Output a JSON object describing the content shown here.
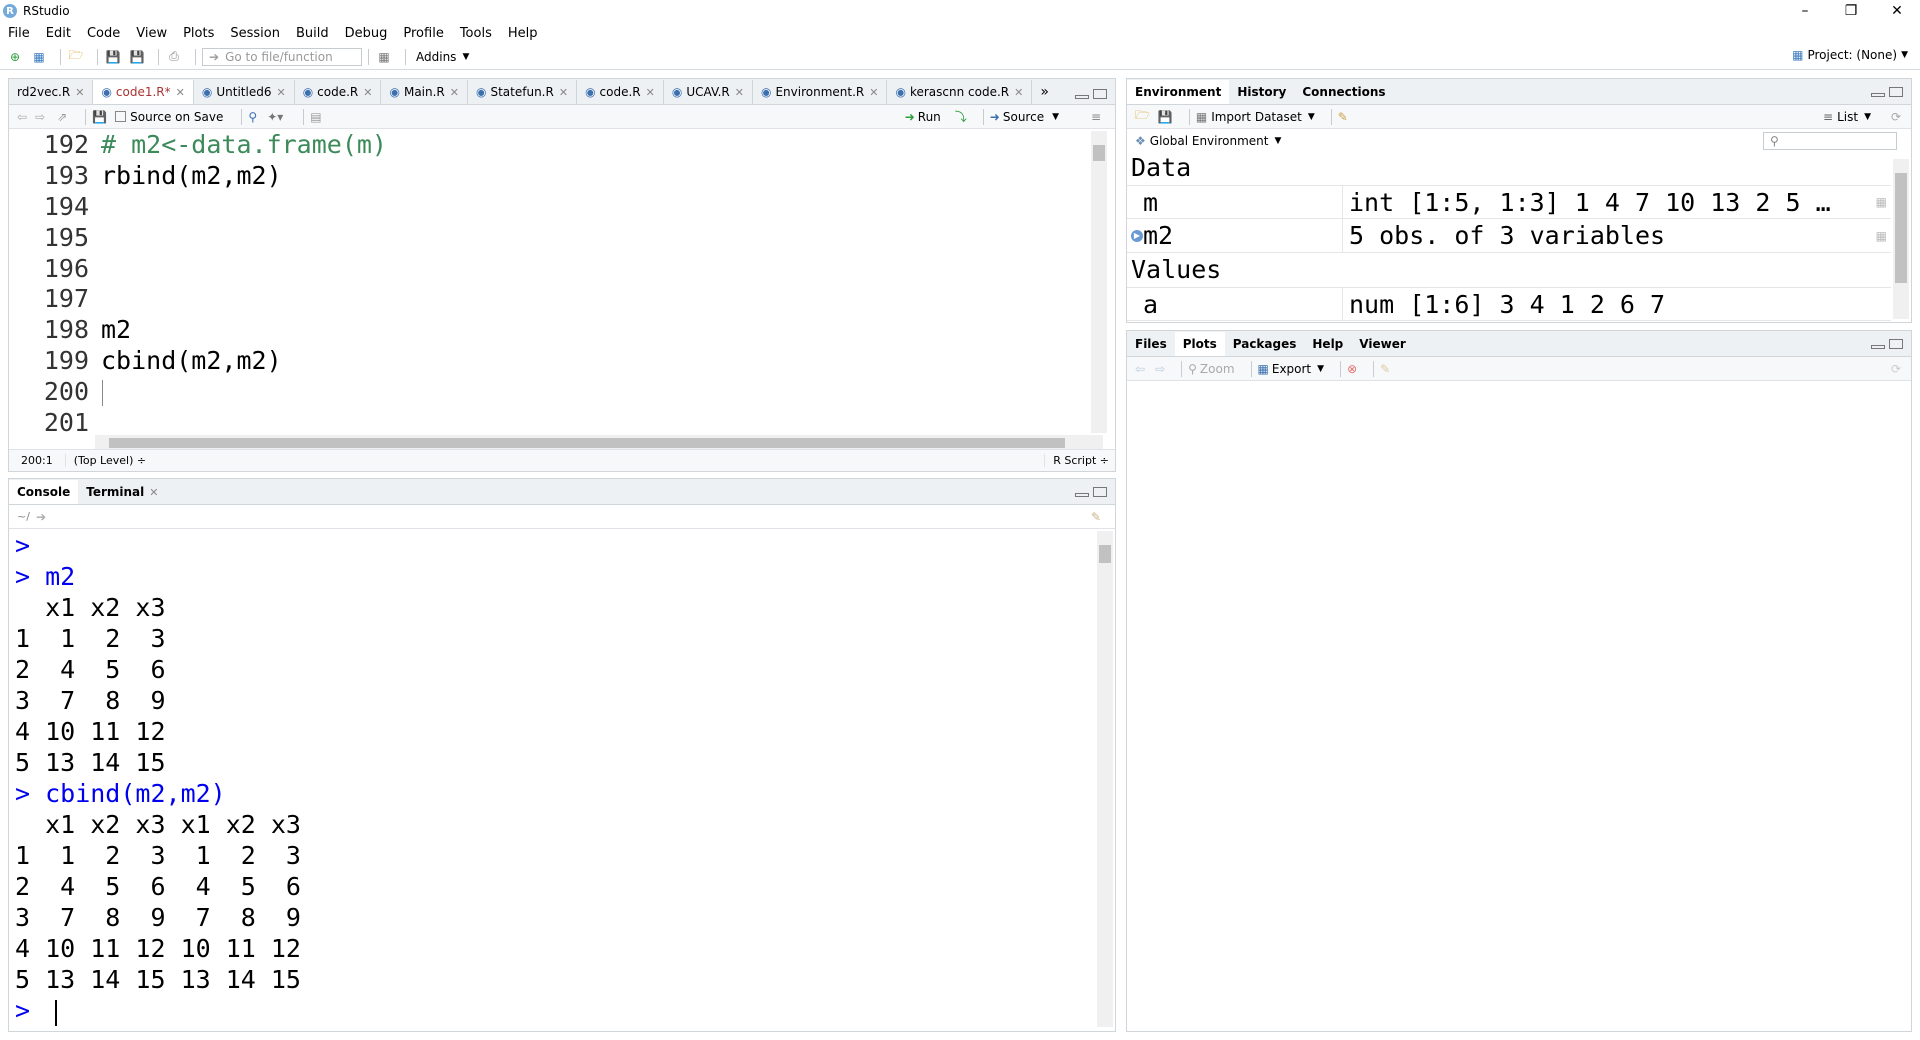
{
  "window": {
    "title": "RStudio"
  },
  "menu": [
    "File",
    "Edit",
    "Code",
    "View",
    "Plots",
    "Session",
    "Build",
    "Debug",
    "Profile",
    "Tools",
    "Help"
  ],
  "toolbar": {
    "goto_placeholder": "Go to file/function",
    "addins": "Addins",
    "project": "Project: (None)"
  },
  "editor": {
    "tabs": [
      {
        "label": "rd2vec.R"
      },
      {
        "label": "code1.R*"
      },
      {
        "label": "Untitled6"
      },
      {
        "label": "code.R"
      },
      {
        "label": "Main.R"
      },
      {
        "label": "Statefun.R"
      },
      {
        "label": "code.R"
      },
      {
        "label": "UCAV.R"
      },
      {
        "label": "Environment.R"
      },
      {
        "label": "kerascnn code.R"
      }
    ],
    "source_on_save": "Source on Save",
    "run": "Run",
    "source": "Source",
    "lines": [
      {
        "num": "192",
        "text": "# m2<-data.frame(m)",
        "comment": true
      },
      {
        "num": "193",
        "text": "rbind(m2,m2)"
      },
      {
        "num": "194",
        "text": ""
      },
      {
        "num": "195",
        "text": ""
      },
      {
        "num": "196",
        "text": ""
      },
      {
        "num": "197",
        "text": ""
      },
      {
        "num": "198",
        "text": "m2"
      },
      {
        "num": "199",
        "text": "cbind(m2,m2)"
      },
      {
        "num": "200",
        "text": ""
      },
      {
        "num": "201",
        "text": ""
      }
    ],
    "status_pos": "200:1",
    "status_scope": "(Top Level) ÷",
    "status_type": "R Script ÷"
  },
  "console": {
    "tabs": [
      "Console",
      "Terminal"
    ],
    "path": "~/",
    "lines": [
      {
        "text": ">",
        "cmd": true
      },
      {
        "text": "> m2",
        "cmd": true
      },
      {
        "text": "  x1 x2 x3"
      },
      {
        "text": "1  1  2  3"
      },
      {
        "text": "2  4  5  6"
      },
      {
        "text": "3  7  8  9"
      },
      {
        "text": "4 10 11 12"
      },
      {
        "text": "5 13 14 15"
      },
      {
        "text": "> cbind(m2,m2)",
        "cmd": true
      },
      {
        "text": "  x1 x2 x3 x1 x2 x3"
      },
      {
        "text": "1  1  2  3  1  2  3"
      },
      {
        "text": "2  4  5  6  4  5  6"
      },
      {
        "text": "3  7  8  9  7  8  9"
      },
      {
        "text": "4 10 11 12 10 11 12"
      },
      {
        "text": "5 13 14 15 13 14 15"
      },
      {
        "text": "> ",
        "cmd": true
      }
    ]
  },
  "environment": {
    "tabs": [
      "Environment",
      "History",
      "Connections"
    ],
    "import_dataset": "Import Dataset",
    "list_view": "List",
    "scope": "Global Environment",
    "section_data": "Data",
    "section_values": "Values",
    "data_rows": [
      {
        "name": "m",
        "value": "int [1:5, 1:3] 1 4 7 10 13 2 5 …"
      },
      {
        "name": "m2",
        "value": "5 obs. of 3 variables"
      }
    ],
    "value_rows": [
      {
        "name": "a",
        "value": "num [1:6] 3 4 1 2 6 7"
      }
    ]
  },
  "files": {
    "tabs": [
      "Files",
      "Plots",
      "Packages",
      "Help",
      "Viewer"
    ],
    "zoom": "Zoom",
    "export": "Export"
  }
}
